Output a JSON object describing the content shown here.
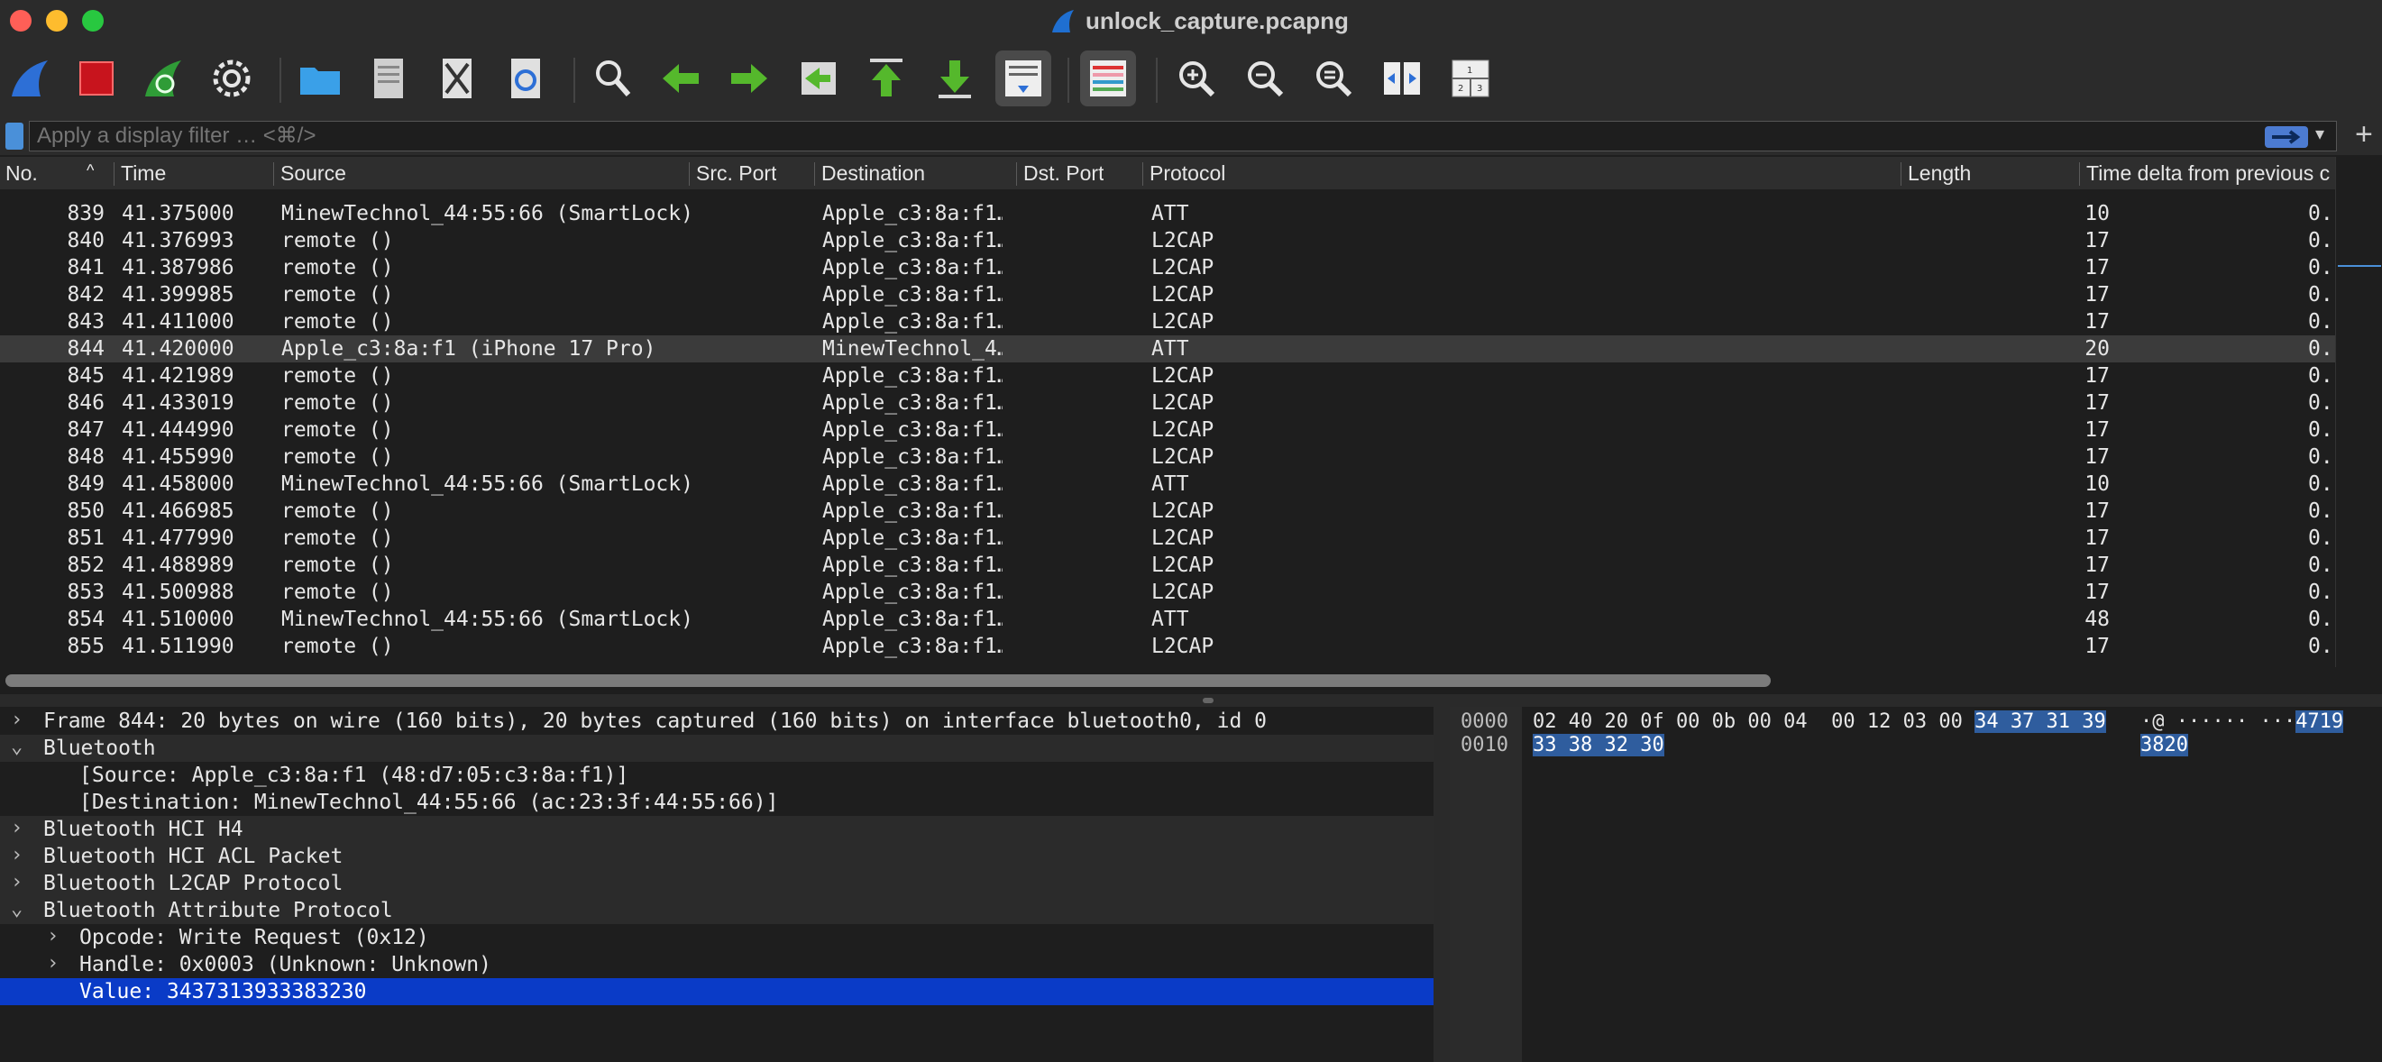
{
  "window": {
    "title": "unlock_capture.pcapng"
  },
  "toolbar": {
    "buttons": [
      {
        "name": "start-capture-icon"
      },
      {
        "name": "stop-capture-icon"
      },
      {
        "name": "restart-capture-icon"
      },
      {
        "name": "capture-options-icon"
      },
      {
        "name": "open-file-icon"
      },
      {
        "name": "save-file-icon"
      },
      {
        "name": "close-file-icon"
      },
      {
        "name": "reload-file-icon"
      },
      {
        "name": "find-packet-icon"
      },
      {
        "name": "go-back-icon"
      },
      {
        "name": "go-forward-icon"
      },
      {
        "name": "go-to-packet-icon"
      },
      {
        "name": "first-packet-icon"
      },
      {
        "name": "last-packet-icon"
      },
      {
        "name": "autoscroll-icon"
      },
      {
        "name": "colorize-icon"
      },
      {
        "name": "zoom-in-icon"
      },
      {
        "name": "zoom-out-icon"
      },
      {
        "name": "normal-size-icon"
      },
      {
        "name": "resize-columns-icon"
      },
      {
        "name": "layout-icon"
      }
    ]
  },
  "filter": {
    "placeholder": "Apply a display filter … <⌘/>"
  },
  "packet_list": {
    "columns": {
      "no": "No.",
      "time": "Time",
      "source": "Source",
      "src_port": "Src. Port",
      "destination": "Destination",
      "dst_port": "Dst. Port",
      "protocol": "Protocol",
      "length": "Length",
      "delta": "Time delta from previous c"
    },
    "rows": [
      {
        "no": "839",
        "time": "41.375000",
        "src": "MinewTechnol_44:55:66 (SmartLock)",
        "dst": "Apple_c3:8a:f1…",
        "proto": "ATT",
        "len": "10",
        "delta": "0."
      },
      {
        "no": "840",
        "time": "41.376993",
        "src": "remote ()",
        "dst": "Apple_c3:8a:f1…",
        "proto": "L2CAP",
        "len": "17",
        "delta": "0."
      },
      {
        "no": "841",
        "time": "41.387986",
        "src": "remote ()",
        "dst": "Apple_c3:8a:f1…",
        "proto": "L2CAP",
        "len": "17",
        "delta": "0."
      },
      {
        "no": "842",
        "time": "41.399985",
        "src": "remote ()",
        "dst": "Apple_c3:8a:f1…",
        "proto": "L2CAP",
        "len": "17",
        "delta": "0."
      },
      {
        "no": "843",
        "time": "41.411000",
        "src": "remote ()",
        "dst": "Apple_c3:8a:f1…",
        "proto": "L2CAP",
        "len": "17",
        "delta": "0."
      },
      {
        "no": "844",
        "time": "41.420000",
        "src": "Apple_c3:8a:f1 (iPhone 17 Pro)",
        "dst": "MinewTechnol_4…",
        "proto": "ATT",
        "len": "20",
        "delta": "0."
      },
      {
        "no": "845",
        "time": "41.421989",
        "src": "remote ()",
        "dst": "Apple_c3:8a:f1…",
        "proto": "L2CAP",
        "len": "17",
        "delta": "0."
      },
      {
        "no": "846",
        "time": "41.433019",
        "src": "remote ()",
        "dst": "Apple_c3:8a:f1…",
        "proto": "L2CAP",
        "len": "17",
        "delta": "0."
      },
      {
        "no": "847",
        "time": "41.444990",
        "src": "remote ()",
        "dst": "Apple_c3:8a:f1…",
        "proto": "L2CAP",
        "len": "17",
        "delta": "0."
      },
      {
        "no": "848",
        "time": "41.455990",
        "src": "remote ()",
        "dst": "Apple_c3:8a:f1…",
        "proto": "L2CAP",
        "len": "17",
        "delta": "0."
      },
      {
        "no": "849",
        "time": "41.458000",
        "src": "MinewTechnol_44:55:66 (SmartLock)",
        "dst": "Apple_c3:8a:f1…",
        "proto": "ATT",
        "len": "10",
        "delta": "0."
      },
      {
        "no": "850",
        "time": "41.466985",
        "src": "remote ()",
        "dst": "Apple_c3:8a:f1…",
        "proto": "L2CAP",
        "len": "17",
        "delta": "0."
      },
      {
        "no": "851",
        "time": "41.477990",
        "src": "remote ()",
        "dst": "Apple_c3:8a:f1…",
        "proto": "L2CAP",
        "len": "17",
        "delta": "0."
      },
      {
        "no": "852",
        "time": "41.488989",
        "src": "remote ()",
        "dst": "Apple_c3:8a:f1…",
        "proto": "L2CAP",
        "len": "17",
        "delta": "0."
      },
      {
        "no": "853",
        "time": "41.500988",
        "src": "remote ()",
        "dst": "Apple_c3:8a:f1…",
        "proto": "L2CAP",
        "len": "17",
        "delta": "0."
      },
      {
        "no": "854",
        "time": "41.510000",
        "src": "MinewTechnol_44:55:66 (SmartLock)",
        "dst": "Apple_c3:8a:f1…",
        "proto": "ATT",
        "len": "48",
        "delta": "0."
      },
      {
        "no": "855",
        "time": "41.511990",
        "src": "remote ()",
        "dst": "Apple_c3:8a:f1…",
        "proto": "L2CAP",
        "len": "17",
        "delta": "0."
      }
    ],
    "selected_no": "844"
  },
  "details": {
    "rows": [
      {
        "indent": 0,
        "chevron": "›",
        "text": "Frame 844: 20 bytes on wire (160 bits), 20 bytes captured (160 bits) on interface bluetooth0, id 0",
        "state": "normal"
      },
      {
        "indent": 0,
        "chevron": "⌄",
        "text": "Bluetooth",
        "state": "shaded"
      },
      {
        "indent": 2,
        "chevron": "",
        "text": "[Source: Apple_c3:8a:f1 (48:d7:05:c3:8a:f1)]",
        "state": "normal"
      },
      {
        "indent": 2,
        "chevron": "",
        "text": "[Destination: MinewTechnol_44:55:66 (ac:23:3f:44:55:66)]",
        "state": "normal"
      },
      {
        "indent": 0,
        "chevron": "›",
        "text": "Bluetooth HCI H4",
        "state": "shaded"
      },
      {
        "indent": 0,
        "chevron": "›",
        "text": "Bluetooth HCI ACL Packet",
        "state": "shaded"
      },
      {
        "indent": 0,
        "chevron": "›",
        "text": "Bluetooth L2CAP Protocol",
        "state": "shaded"
      },
      {
        "indent": 0,
        "chevron": "⌄",
        "text": "Bluetooth Attribute Protocol",
        "state": "shaded"
      },
      {
        "indent": 1,
        "chevron": "›",
        "text": "Opcode: Write Request (0x12)",
        "state": "normal"
      },
      {
        "indent": 1,
        "chevron": "›",
        "text": "Handle: 0x0003 (Unknown: Unknown)",
        "state": "normal"
      },
      {
        "indent": 2,
        "chevron": "",
        "text": "Value: 3437313933383230",
        "state": "selected"
      }
    ]
  },
  "bytes": {
    "rows": [
      {
        "offset": "0000",
        "hex_plain": "02 40 20 0f 00 0b 00 04  00 12 03 00 ",
        "hex_hl": "34 37 31 39",
        "ascii_plain": "·@ ······ ···",
        "ascii_hl": "4719"
      },
      {
        "offset": "0010",
        "hex_plain": "",
        "hex_hl": "33 38 32 30",
        "ascii_plain": "",
        "ascii_hl": "3820"
      }
    ]
  },
  "colors": {
    "background": "#1e1e1e",
    "selection_blue": "#0a3bc7",
    "byte_highlight": "#2f5d9e"
  }
}
